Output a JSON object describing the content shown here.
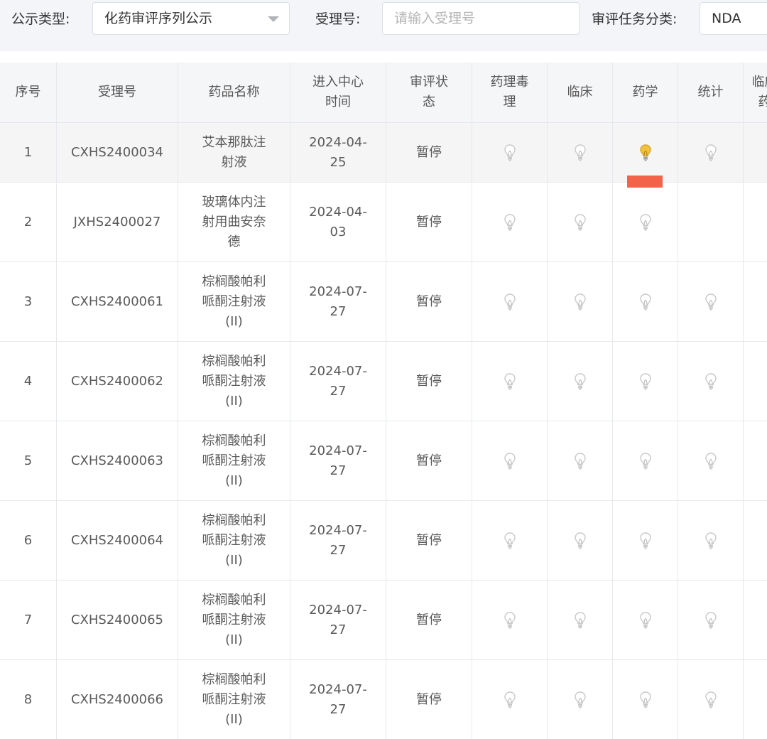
{
  "filters": {
    "type_label": "公示类型:",
    "type_value": "化药审评序列公示",
    "accept_label": "受理号:",
    "accept_placeholder": "请输入受理号",
    "task_label": "审评任务分类:",
    "task_value": "NDA"
  },
  "table": {
    "headers": [
      "序号",
      "受理号",
      "药品名称",
      "进入中心时间",
      "审评状态",
      "药理毒理",
      "临床",
      "药学",
      "统计",
      "临床药"
    ],
    "rows": [
      {
        "no": "1",
        "accept": "CXHS2400034",
        "name": "艾本那肽注射液",
        "date": "2024-04-25",
        "status": "暂停",
        "lights": [
          "off",
          "off",
          "on",
          "off"
        ]
      },
      {
        "no": "2",
        "accept": "JXHS2400027",
        "name": "玻璃体内注射用曲安奈德",
        "date": "2024-04-03",
        "status": "暂停",
        "lights": [
          "off",
          "off",
          "off",
          "none"
        ]
      },
      {
        "no": "3",
        "accept": "CXHS2400061",
        "name": "棕榈酸帕利哌酮注射液(II)",
        "date": "2024-07-27",
        "status": "暂停",
        "lights": [
          "off",
          "off",
          "off",
          "off"
        ]
      },
      {
        "no": "4",
        "accept": "CXHS2400062",
        "name": "棕榈酸帕利哌酮注射液(II)",
        "date": "2024-07-27",
        "status": "暂停",
        "lights": [
          "off",
          "off",
          "off",
          "off"
        ]
      },
      {
        "no": "5",
        "accept": "CXHS2400063",
        "name": "棕榈酸帕利哌酮注射液(II)",
        "date": "2024-07-27",
        "status": "暂停",
        "lights": [
          "off",
          "off",
          "off",
          "off"
        ]
      },
      {
        "no": "6",
        "accept": "CXHS2400064",
        "name": "棕榈酸帕利哌酮注射液(II)",
        "date": "2024-07-27",
        "status": "暂停",
        "lights": [
          "off",
          "off",
          "off",
          "off"
        ]
      },
      {
        "no": "7",
        "accept": "CXHS2400065",
        "name": "棕榈酸帕利哌酮注射液(II)",
        "date": "2024-07-27",
        "status": "暂停",
        "lights": [
          "off",
          "off",
          "off",
          "off"
        ]
      },
      {
        "no": "8",
        "accept": "CXHS2400066",
        "name": "棕榈酸帕利哌酮注射液(II)",
        "date": "2024-07-27",
        "status": "暂停",
        "lights": [
          "off",
          "off",
          "off",
          "off"
        ]
      }
    ]
  },
  "colors": {
    "bulb_off": "#c9c9c9",
    "bulb_on": "#f2c23c",
    "highlight_marker": "#f2634a"
  },
  "icons": {
    "bulb": "lightbulb-icon",
    "dropdown": "caret-down-icon"
  }
}
